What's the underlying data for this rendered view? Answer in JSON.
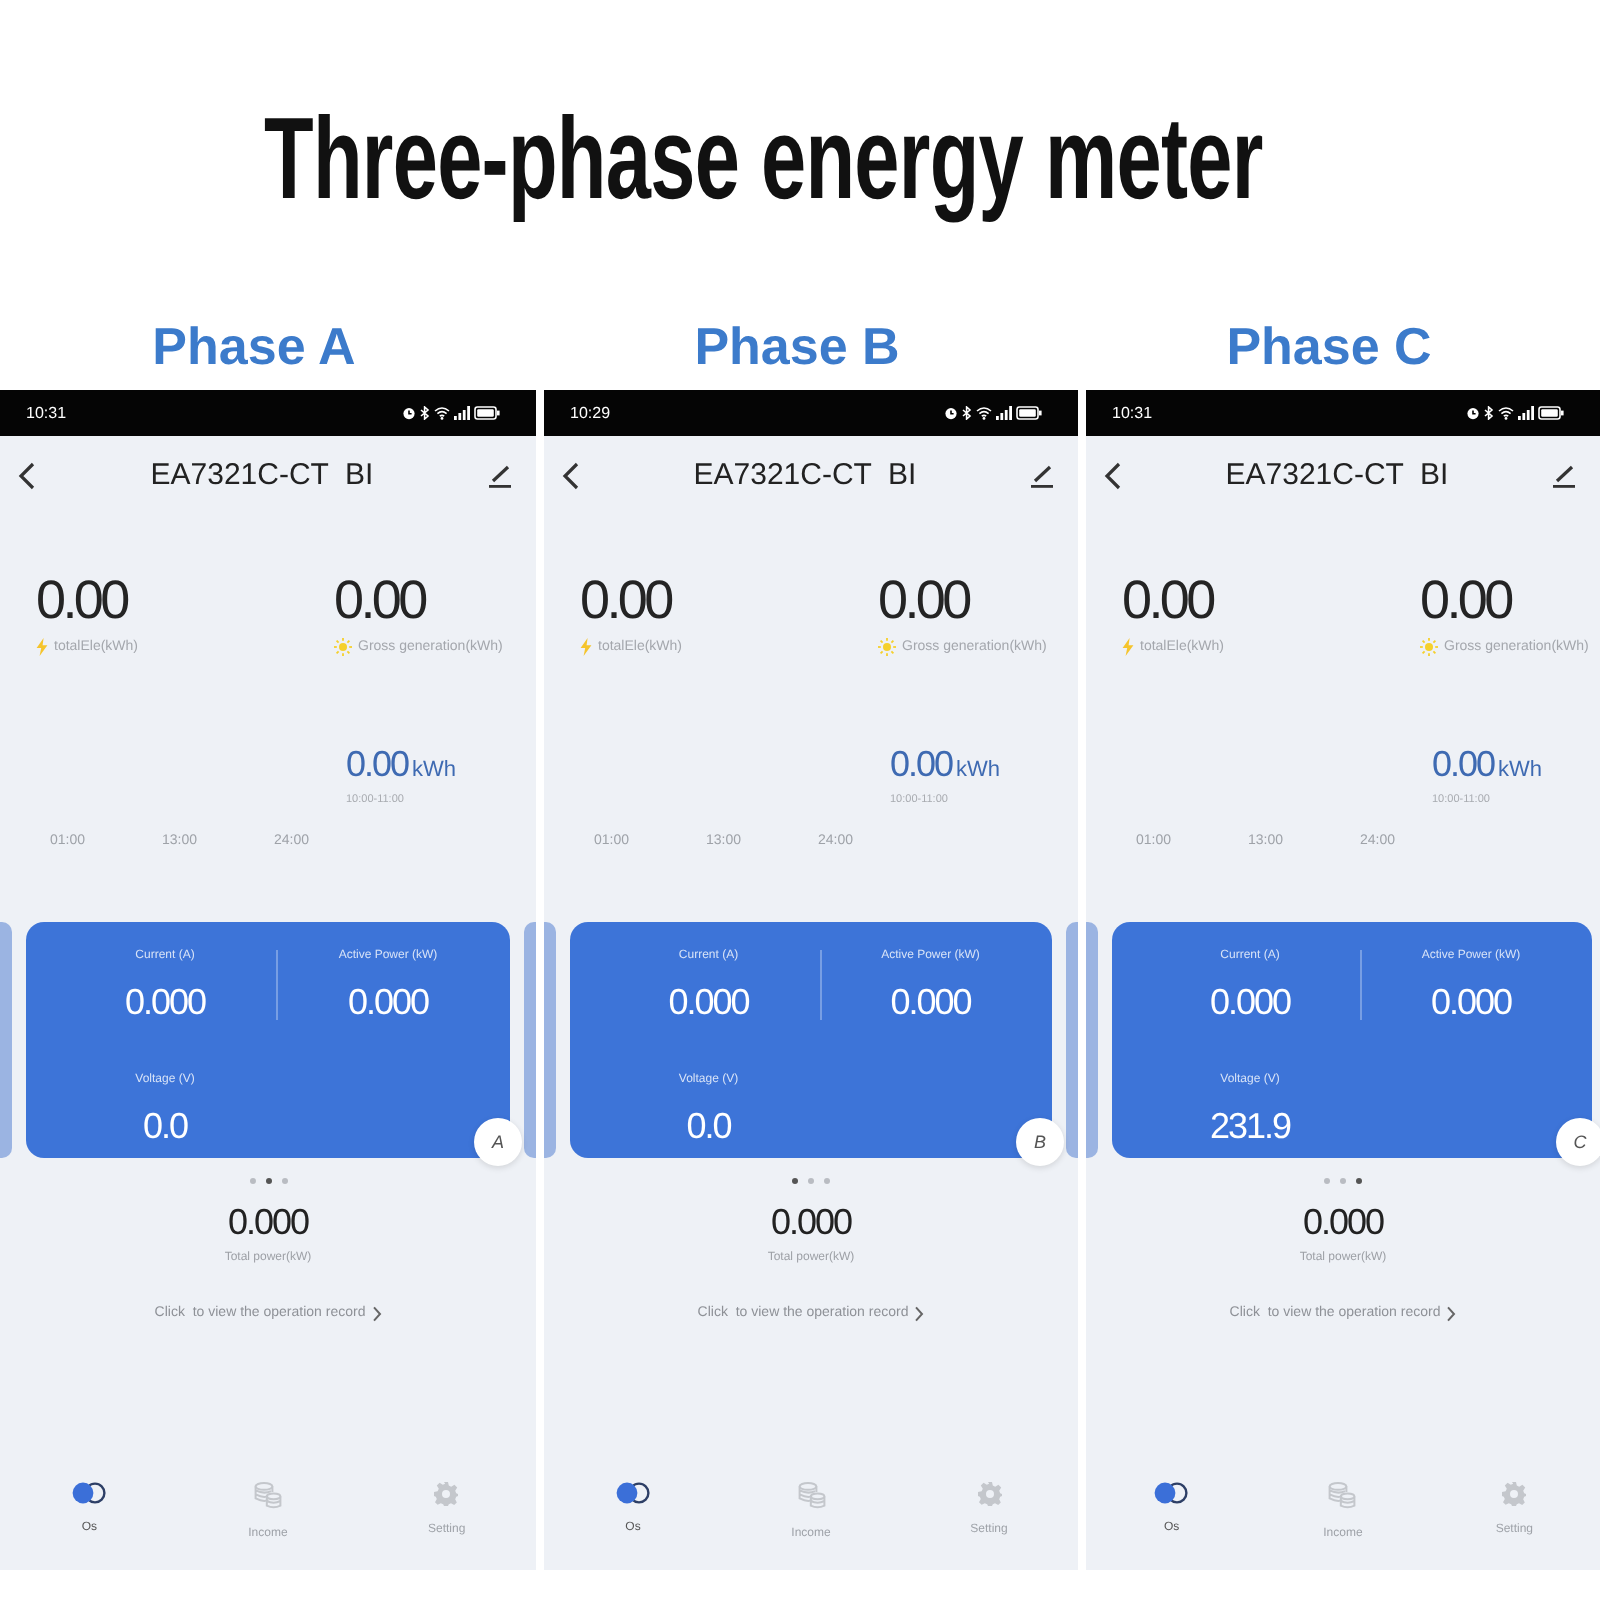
{
  "title": "Three-phase energy meter",
  "phases": [
    {
      "label": "Phase A",
      "status_bar": {
        "time": "10:31"
      },
      "header": {
        "title": "EA7321C-CT  BI"
      },
      "totals": [
        {
          "kind": "consumption",
          "value": "0.00",
          "label": "totalEle(kWh)"
        },
        {
          "kind": "generation",
          "value": "0.00",
          "label": "Gross  generation(kWh)"
        }
      ],
      "period": {
        "value": "0.00",
        "unit": "kWh",
        "range": "10:00-11:00"
      },
      "time_axis": [
        "01:00",
        "13:00",
        "24:00"
      ],
      "card": {
        "metrics": [
          {
            "label": "Current (A)",
            "value": "0.000"
          },
          {
            "label": "Active Power (kW)",
            "value": "0.000"
          },
          {
            "label": "Voltage (V)",
            "value": "0.0"
          }
        ],
        "badge": "A"
      },
      "pager": [
        {
          "selected": false
        },
        {
          "selected": true
        },
        {
          "selected": false
        }
      ],
      "total_power": {
        "value": "0.000",
        "label": "Total power(kW)"
      },
      "record_link": "Click  to view the operation record",
      "nav": [
        {
          "kind": "switch",
          "label": "Os",
          "selected": true
        },
        {
          "kind": "coins",
          "label": "Income",
          "selected": false
        },
        {
          "kind": "settings",
          "label": "Setting",
          "selected": false
        }
      ]
    },
    {
      "label": "Phase B",
      "status_bar": {
        "time": "10:29"
      },
      "header": {
        "title": "EA7321C-CT  BI"
      },
      "totals": [
        {
          "kind": "consumption",
          "value": "0.00",
          "label": "totalEle(kWh)"
        },
        {
          "kind": "generation",
          "value": "0.00",
          "label": "Gross  generation(kWh)"
        }
      ],
      "period": {
        "value": "0.00",
        "unit": "kWh",
        "range": "10:00-11:00"
      },
      "time_axis": [
        "01:00",
        "13:00",
        "24:00"
      ],
      "card": {
        "metrics": [
          {
            "label": "Current (A)",
            "value": "0.000"
          },
          {
            "label": "Active Power (kW)",
            "value": "0.000"
          },
          {
            "label": "Voltage (V)",
            "value": "0.0"
          }
        ],
        "badge": "B"
      },
      "pager": [
        {
          "selected": true
        },
        {
          "selected": false
        },
        {
          "selected": false
        }
      ],
      "total_power": {
        "value": "0.000",
        "label": "Total power(kW)"
      },
      "record_link": "Click  to view the operation record",
      "nav": [
        {
          "kind": "switch",
          "label": "Os",
          "selected": true
        },
        {
          "kind": "coins",
          "label": "Income",
          "selected": false
        },
        {
          "kind": "settings",
          "label": "Setting",
          "selected": false
        }
      ]
    },
    {
      "label": "Phase C",
      "status_bar": {
        "time": "10:31"
      },
      "header": {
        "title": "EA7321C-CT  BI"
      },
      "totals": [
        {
          "kind": "consumption",
          "value": "0.00",
          "label": "totalEle(kWh)"
        },
        {
          "kind": "generation",
          "value": "0.00",
          "label": "Gross  generation(kWh)"
        }
      ],
      "period": {
        "value": "0.00",
        "unit": "kWh",
        "range": "10:00-11:00"
      },
      "time_axis": [
        "01:00",
        "13:00",
        "24:00"
      ],
      "card": {
        "metrics": [
          {
            "label": "Current (A)",
            "value": "0.000"
          },
          {
            "label": "Active Power (kW)",
            "value": "0.000"
          },
          {
            "label": "Voltage (V)",
            "value": "231.9"
          }
        ],
        "badge": "C"
      },
      "pager": [
        {
          "selected": false
        },
        {
          "selected": false
        },
        {
          "selected": true
        }
      ],
      "total_power": {
        "value": "0.000",
        "label": "Total power(kW)"
      },
      "record_link": "Click  to view the operation record",
      "nav": [
        {
          "kind": "switch",
          "label": "Os",
          "selected": true
        },
        {
          "kind": "coins",
          "label": "Income",
          "selected": false
        },
        {
          "kind": "settings",
          "label": "Setting",
          "selected": false
        }
      ]
    }
  ]
}
